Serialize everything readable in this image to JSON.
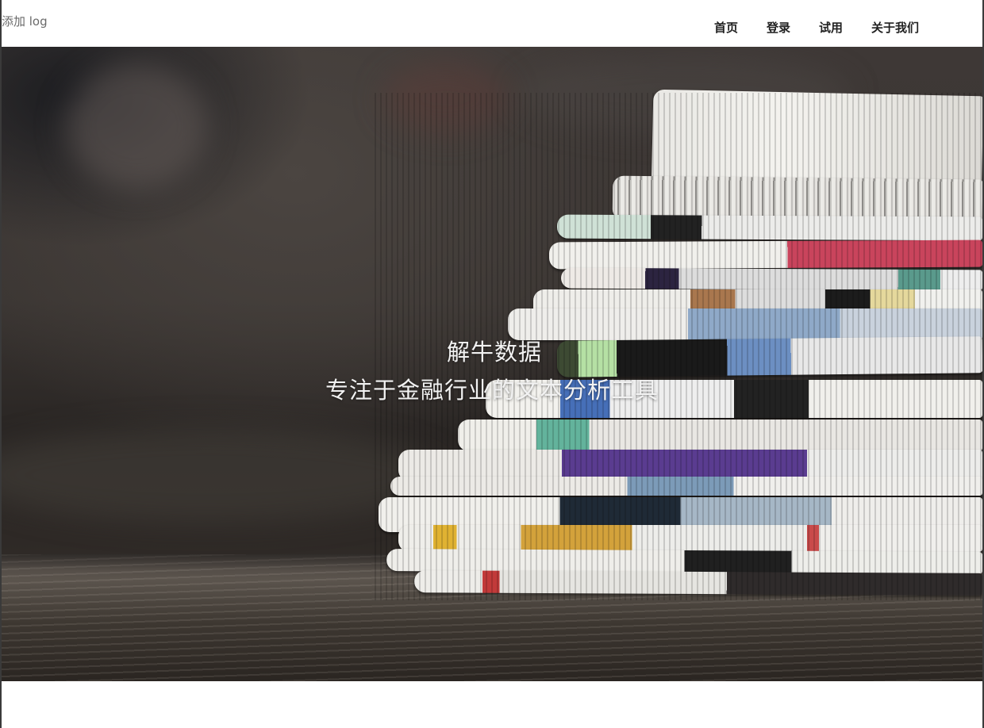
{
  "header": {
    "logo_alt_text": "添加 log",
    "nav": [
      {
        "label": "首页"
      },
      {
        "label": "登录"
      },
      {
        "label": "试用"
      },
      {
        "label": "关于我们"
      }
    ]
  },
  "hero": {
    "title": "解牛数据",
    "subtitle": "专注于金融行业的文本分析工具",
    "background_image": "stack-of-newspapers-photo"
  }
}
